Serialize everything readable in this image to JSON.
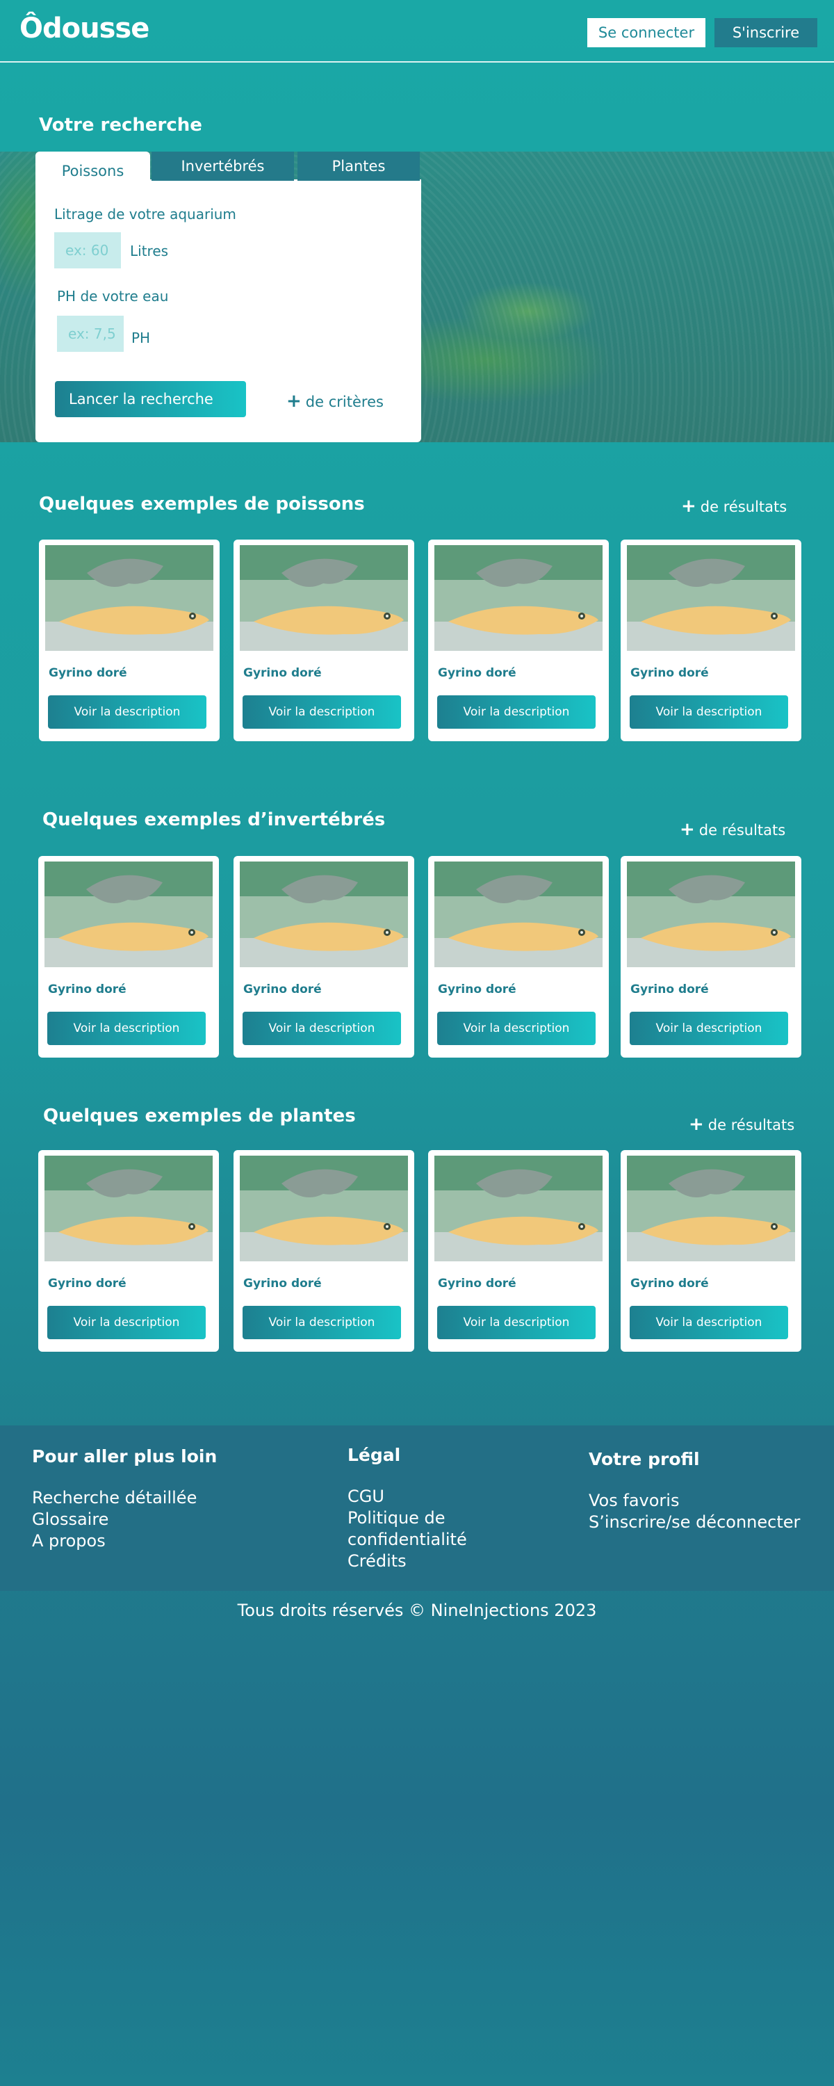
{
  "header": {
    "logo": "Ôdousse",
    "login_label": "Se connecter",
    "signup_label": "S'inscrire"
  },
  "search": {
    "title": "Votre recherche",
    "tabs": [
      "Poissons",
      "Invertébrés",
      "Plantes"
    ],
    "volume_label": "Litrage de votre aquarium",
    "volume_placeholder": "ex: 60",
    "volume_unit": "Litres",
    "ph_label": "PH de votre eau",
    "ph_placeholder": "ex: 7,5",
    "ph_unit": "PH",
    "submit_label": "Lancer la recherche",
    "more_criteria_label": "de critères"
  },
  "sections": [
    {
      "title": "Quelques exemples de poissons",
      "more_label": "de résultats",
      "cards": [
        {
          "name": "Gyrino doré",
          "button": "Voir la description"
        },
        {
          "name": "Gyrino doré",
          "button": "Voir la description"
        },
        {
          "name": "Gyrino doré",
          "button": "Voir la description"
        },
        {
          "name": "Gyrino doré",
          "button": "Voir la description"
        }
      ]
    },
    {
      "title": "Quelques exemples d’invertébrés",
      "more_label": "de résultats",
      "cards": [
        {
          "name": "Gyrino doré",
          "button": "Voir la description"
        },
        {
          "name": "Gyrino doré",
          "button": "Voir la description"
        },
        {
          "name": "Gyrino doré",
          "button": "Voir la description"
        },
        {
          "name": "Gyrino doré",
          "button": "Voir la description"
        }
      ]
    },
    {
      "title": "Quelques exemples de plantes",
      "more_label": "de résultats",
      "cards": [
        {
          "name": "Gyrino doré",
          "button": "Voir la description"
        },
        {
          "name": "Gyrino doré",
          "button": "Voir la description"
        },
        {
          "name": "Gyrino doré",
          "button": "Voir la description"
        },
        {
          "name": "Gyrino doré",
          "button": "Voir la description"
        }
      ]
    }
  ],
  "footer": {
    "columns": [
      {
        "heading": "Pour aller plus loin",
        "links": [
          "Recherche détaillée",
          "Glossaire",
          "A propos"
        ]
      },
      {
        "heading": "Légal",
        "links": [
          "CGU",
          "Politique de",
          "confidentialité",
          "Crédits"
        ]
      },
      {
        "heading": "Votre profil",
        "links": [
          "Vos favoris",
          "S’inscrire/se déconnecter"
        ]
      }
    ],
    "copyright": "Tous droits réservés © NineInjections 2023"
  },
  "colors": {
    "accent": "#1f7d8d",
    "button_gradient_start": "#1d8090",
    "button_gradient_end": "#19c3c6",
    "footer_bg": "#236f86"
  },
  "icons": {
    "plus": "plus-icon"
  }
}
